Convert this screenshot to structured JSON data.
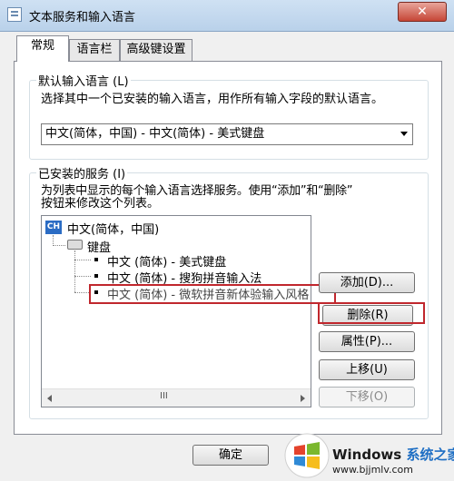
{
  "window": {
    "title": "文本服务和输入语言",
    "close_glyph": "✕"
  },
  "tabs": [
    {
      "label": "常规",
      "active": true
    },
    {
      "label": "语言栏",
      "active": false
    },
    {
      "label": "高级键设置",
      "active": false
    }
  ],
  "default_language": {
    "legend": "默认输入语言 (L)",
    "description": "选择其中一个已安装的输入语言，用作所有输入字段的默认语言。",
    "selected": "中文(简体，中国) - 中文(简体) - 美式键盘"
  },
  "installed_services": {
    "legend": "已安装的服务 (I)",
    "description_line1": "为列表中显示的每个输入语言选择服务。使用“添加”和“删除”",
    "description_line2": "按钮来修改这个列表。",
    "language_badge": "CH",
    "language": "中文(简体，中国)",
    "category": "键盘",
    "items": [
      "中文 (简体) - 美式键盘",
      "中文 (简体) - 搜狗拼音输入法",
      "中文 (简体) - 微软拼音新体验输入风格"
    ],
    "scroll_grip": "III"
  },
  "buttons": {
    "add": "添加(D)...",
    "remove": "删除(R)",
    "properties": "属性(P)...",
    "move_up": "上移(U)",
    "move_down": "下移(O)",
    "ok": "确定"
  },
  "watermark": {
    "brand": "Windows",
    "suffix": "系统之家",
    "url": "www.bjjmlv.com"
  },
  "colors": {
    "highlight": "#c0272d",
    "language_badge": "#2b6cc4"
  }
}
